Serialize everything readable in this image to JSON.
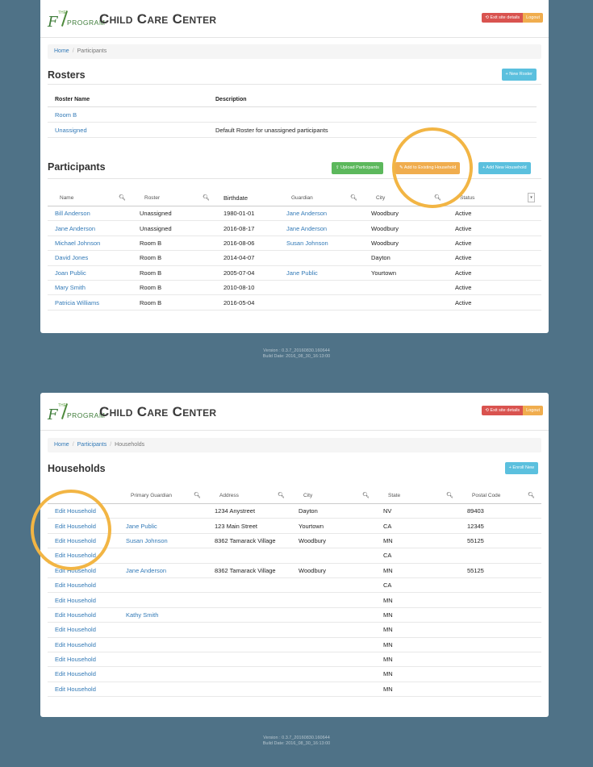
{
  "app": {
    "logo_small": "THE",
    "logo_big": "F",
    "logo_word": "PROGRAM",
    "title": "Child Care Center",
    "exit_label": "⟲ Exit site details",
    "logout_label": "Logout"
  },
  "top": {
    "breadcrumb": [
      "Home",
      "Participants"
    ],
    "rosters_title": "Rosters",
    "new_roster_label": "+ New Roster",
    "rosters_headers": [
      "Roster Name",
      "Description"
    ],
    "rosters": [
      {
        "name": "Room B",
        "description": ""
      },
      {
        "name": "Unassigned",
        "description": "Default Roster for unassigned participants"
      }
    ],
    "participants_title": "Participants",
    "upload_label": "⇪ Upload Participants",
    "add_existing_label": "✎ Add to Existing Household",
    "add_new_label": "+ Add New Household",
    "headers": [
      "Name",
      "Roster",
      "Birthdate",
      "Guardian",
      "City",
      "Status"
    ],
    "participants": [
      {
        "name": "Bill Anderson",
        "roster": "Unassigned",
        "birthdate": "1980-01-01",
        "guardian": "Jane Anderson",
        "city": "Woodbury",
        "status": "Active"
      },
      {
        "name": "Jane Anderson",
        "roster": "Unassigned",
        "birthdate": "2016-08-17",
        "guardian": "Jane Anderson",
        "city": "Woodbury",
        "status": "Active"
      },
      {
        "name": "Michael Johnson",
        "roster": "Room B",
        "birthdate": "2016-08-06",
        "guardian": "Susan Johnson",
        "city": "Woodbury",
        "status": "Active"
      },
      {
        "name": "David Jones",
        "roster": "Room B",
        "birthdate": "2014-04-07",
        "guardian": "",
        "city": "Dayton",
        "status": "Active"
      },
      {
        "name": "Joan Public",
        "roster": "Room B",
        "birthdate": "2005-07-04",
        "guardian": "Jane Public",
        "city": "Yourtown",
        "status": "Active"
      },
      {
        "name": "Mary Smith",
        "roster": "Room B",
        "birthdate": "2010-08-10",
        "guardian": "",
        "city": "",
        "status": "Active"
      },
      {
        "name": "Patricia Williams",
        "roster": "Room B",
        "birthdate": "2016-05-04",
        "guardian": "",
        "city": "",
        "status": "Active"
      }
    ],
    "footer_version": "Version : 0.3.7_20160830.160644",
    "footer_build": "Build Date: 2016_08_30_16:13:00"
  },
  "bottom": {
    "breadcrumb": [
      "Home",
      "Participants",
      "Households"
    ],
    "households_title": "Households",
    "enroll_label": "+ Enroll New",
    "headers": [
      "",
      "Primary Guardian",
      "Address",
      "City",
      "State",
      "Postal Code"
    ],
    "households": [
      {
        "action": "Edit Household",
        "guardian": "",
        "address": "1234 Anystreet",
        "city": "Dayton",
        "state": "NV",
        "postal": "89403"
      },
      {
        "action": "Edit Household",
        "guardian": "Jane Public",
        "address": "123 Main Street",
        "city": "Yourtown",
        "state": "CA",
        "postal": "12345"
      },
      {
        "action": "Edit Household",
        "guardian": "Susan Johnson",
        "address": "8362 Tamarack Village",
        "city": "Woodbury",
        "state": "MN",
        "postal": "55125"
      },
      {
        "action": "Edit Household",
        "guardian": "",
        "address": "",
        "city": "",
        "state": "CA",
        "postal": ""
      },
      {
        "action": "Edit Household",
        "guardian": "Jane Anderson",
        "address": "8362 Tamarack Village",
        "city": "Woodbury",
        "state": "MN",
        "postal": "55125"
      },
      {
        "action": "Edit Household",
        "guardian": "",
        "address": "",
        "city": "",
        "state": "CA",
        "postal": ""
      },
      {
        "action": "Edit Household",
        "guardian": "",
        "address": "",
        "city": "",
        "state": "MN",
        "postal": ""
      },
      {
        "action": "Edit Household",
        "guardian": "Kathy Smith",
        "address": "",
        "city": "",
        "state": "MN",
        "postal": ""
      },
      {
        "action": "Edit Household",
        "guardian": "",
        "address": "",
        "city": "",
        "state": "MN",
        "postal": ""
      },
      {
        "action": "Edit Household",
        "guardian": "",
        "address": "",
        "city": "",
        "state": "MN",
        "postal": ""
      },
      {
        "action": "Edit Household",
        "guardian": "",
        "address": "",
        "city": "",
        "state": "MN",
        "postal": ""
      },
      {
        "action": "Edit Household",
        "guardian": "",
        "address": "",
        "city": "",
        "state": "MN",
        "postal": ""
      },
      {
        "action": "Edit Household",
        "guardian": "",
        "address": "",
        "city": "",
        "state": "MN",
        "postal": ""
      }
    ],
    "footer_version": "Version : 0.3.7_20160830.160644",
    "footer_build": "Build Date: 2016_08_30_16:13:00"
  },
  "colors": {
    "background": "#4f7287",
    "link": "#337ab7",
    "highlight_circle": "#f2b544",
    "danger": "#d9534f",
    "warning": "#f0ad4e",
    "success": "#5cb85c",
    "info": "#5bc0de"
  }
}
